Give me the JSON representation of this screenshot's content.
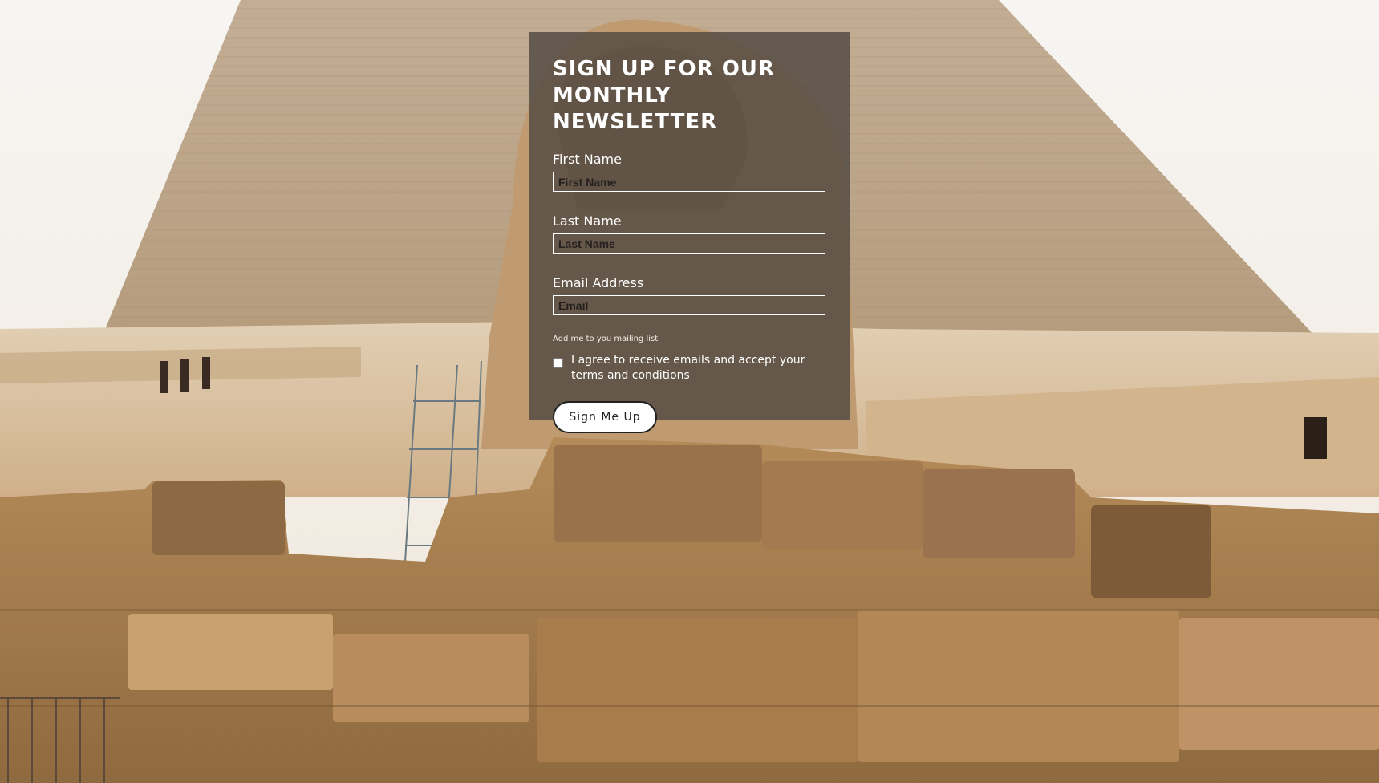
{
  "form": {
    "title_line1": "SIGN UP FOR OUR",
    "title_line2": "MONTHLY NEWSLETTER",
    "fields": [
      {
        "label": "First Name",
        "placeholder": "First Name",
        "value": ""
      },
      {
        "label": "Last Name",
        "placeholder": "Last Name",
        "value": ""
      },
      {
        "label": "Email Address",
        "placeholder": "Email",
        "value": ""
      }
    ],
    "mailing_note": "Add me to you mailing list",
    "agree_text": "I agree to receive emails and accept your terms and conditions",
    "agree_checked": false,
    "submit_label": "Sign Me Up"
  },
  "colors": {
    "panel_overlay": "#4e4640",
    "sky": "#f4f2ef",
    "pyramid": "#c9b49c",
    "sand": "#d8c2a2",
    "stone": "#a57c4e",
    "button_bg": "#ffffff"
  }
}
